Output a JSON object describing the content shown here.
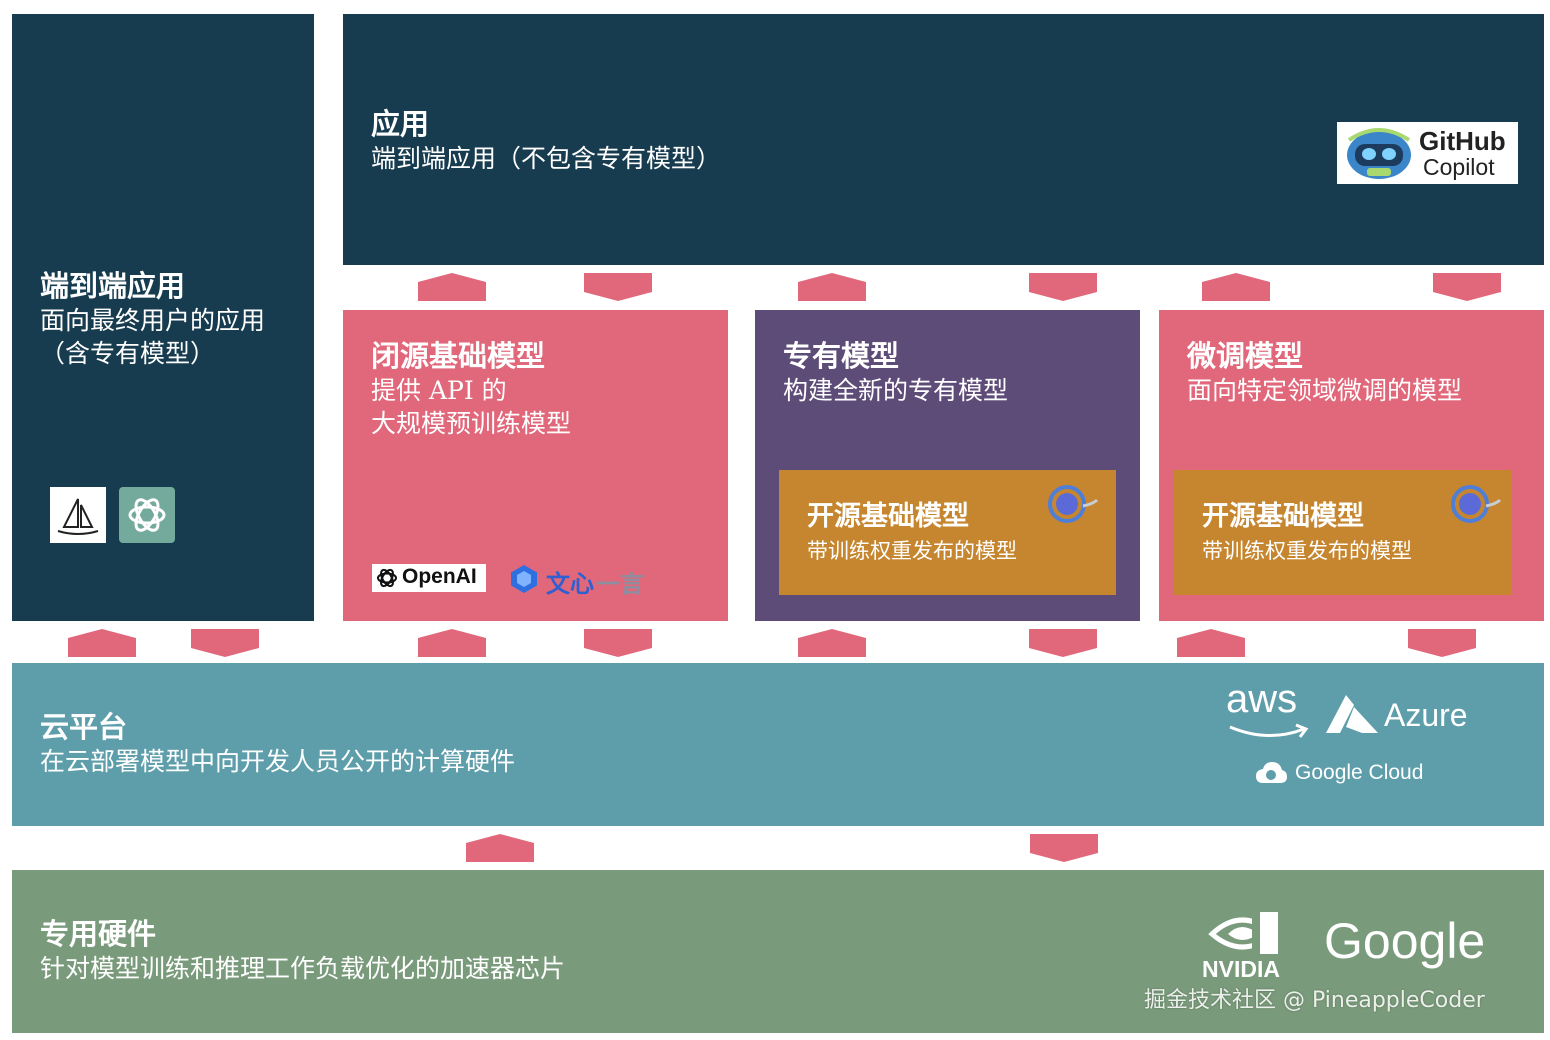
{
  "end_to_end": {
    "title": "端到端应用",
    "subtitle": "面向最终用户的应用\n（含专有模型）",
    "logos": [
      "midjourney-logo",
      "chatgpt-logo"
    ]
  },
  "applications": {
    "title": "应用",
    "subtitle": "端到端应用（不包含专有模型）",
    "logo": {
      "line1": "GitHub",
      "line2": "Copilot"
    }
  },
  "closed_source": {
    "title": "闭源基础模型",
    "subtitle": "提供 API 的\n大规模预训练模型",
    "logo_openai": "OpenAI",
    "logo_wenxin_a": "文心",
    "logo_wenxin_b": "一言"
  },
  "proprietary": {
    "title": "专有模型",
    "subtitle": "构建全新的专有模型",
    "open_source": {
      "title": "开源基础模型",
      "subtitle": "带训练权重发布的模型"
    }
  },
  "fine_tuned": {
    "title": "微调模型",
    "subtitle": "面向特定领域微调的模型",
    "open_source": {
      "title": "开源基础模型",
      "subtitle": "带训练权重发布的模型"
    }
  },
  "cloud": {
    "title": "云平台",
    "subtitle": "在云部署模型中向开发人员公开的计算硬件",
    "logo_aws": "aws",
    "logo_azure": "Azure",
    "logo_gcloud": "Google Cloud"
  },
  "hardware": {
    "title": "专用硬件",
    "subtitle": "针对模型训练和推理工作负载优化的加速器芯片",
    "logo_nvidia": "NVIDIA",
    "logo_google": "Google"
  },
  "watermark": "掘金技术社区 @ PineappleCoder",
  "colors": {
    "navy": "#173b4f",
    "pink": "#e1677a",
    "purple": "#5e4c78",
    "orange": "#c6862f",
    "teal": "#5e9eab",
    "green": "#7a9b7b"
  }
}
